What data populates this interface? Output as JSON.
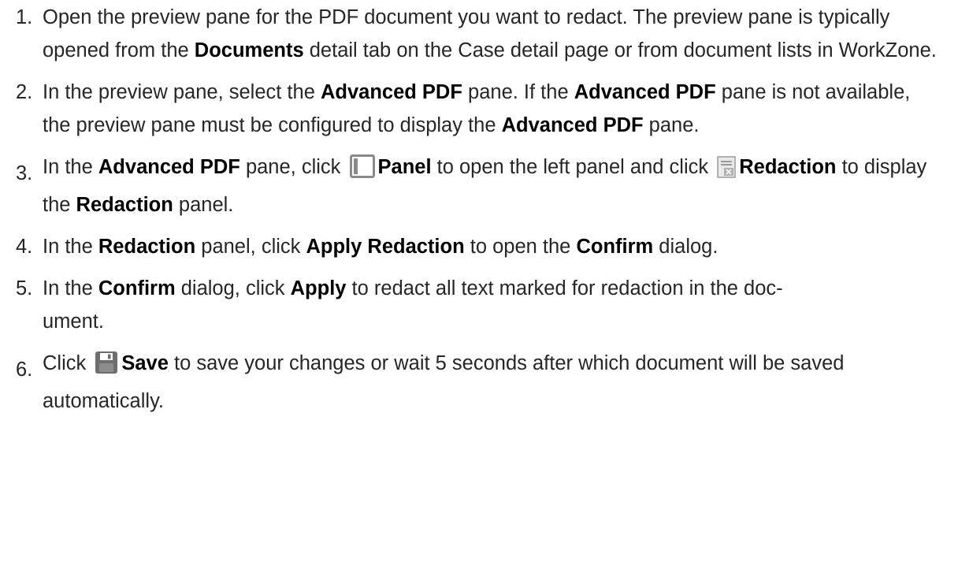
{
  "steps": [
    {
      "number": "1.",
      "parts": [
        {
          "t": "Open the preview pane for the PDF document you want to redact. The preview pane is typically opened from the "
        },
        {
          "t": "Documents",
          "b": true
        },
        {
          "t": " detail tab on the Case detail page or from document lists in WorkZone."
        }
      ]
    },
    {
      "number": "2.",
      "parts": [
        {
          "t": "In the preview pane, select the "
        },
        {
          "t": "Advanced PDF",
          "b": true
        },
        {
          "t": " pane. If the "
        },
        {
          "t": "Advanced PDF",
          "b": true
        },
        {
          "t": " pane is not available, the preview pane must be configured to display the "
        },
        {
          "t": "Advanced PDF",
          "b": true
        },
        {
          "t": " pane."
        }
      ]
    },
    {
      "number": "3.",
      "parts": [
        {
          "t": "In the "
        },
        {
          "t": "Advanced PDF",
          "b": true
        },
        {
          "t": " pane, click "
        },
        {
          "icon": "panel-icon"
        },
        {
          "t": "Panel",
          "b": true
        },
        {
          "t": " to open the left panel and click "
        },
        {
          "icon": "redaction-icon"
        },
        {
          "t": "Redaction",
          "b": true
        },
        {
          "t": " to display the "
        },
        {
          "t": "Redaction",
          "b": true
        },
        {
          "t": " panel."
        }
      ]
    },
    {
      "number": "4.",
      "parts": [
        {
          "t": "In the "
        },
        {
          "t": "Redaction",
          "b": true
        },
        {
          "t": " panel, click "
        },
        {
          "t": "Apply Redaction",
          "b": true
        },
        {
          "t": " to open the "
        },
        {
          "t": "Confirm",
          "b": true
        },
        {
          "t": " dialog."
        }
      ]
    },
    {
      "number": "5.",
      "parts": [
        {
          "t": "In the "
        },
        {
          "t": "Confirm",
          "b": true
        },
        {
          "t": " dialog, click "
        },
        {
          "t": "Apply",
          "b": true
        },
        {
          "t": " to redact all text marked for redaction in the doc-"
        },
        {
          "br": true
        },
        {
          "t": "ument."
        }
      ]
    },
    {
      "number": "6.",
      "parts": [
        {
          "t": "Click "
        },
        {
          "icon": "save-icon"
        },
        {
          "t": "Save",
          "b": true
        },
        {
          "t": " to save your changes or wait 5 seconds after which document will be saved automatically."
        }
      ]
    }
  ]
}
